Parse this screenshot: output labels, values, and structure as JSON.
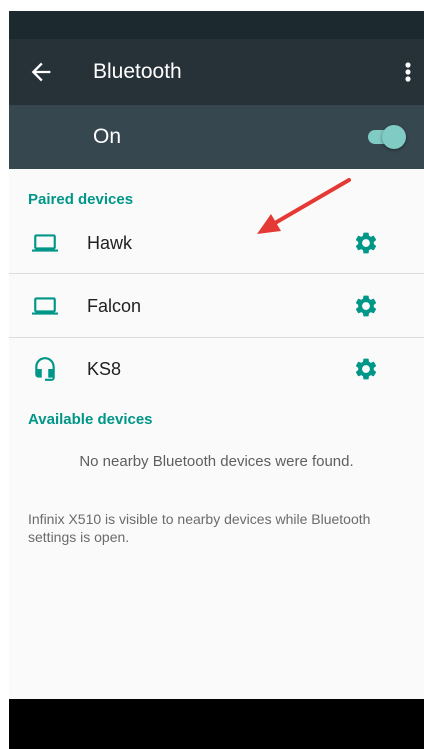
{
  "toolbar": {
    "title": "Bluetooth",
    "back_icon": "arrow-back-icon",
    "menu_icon": "more-vert-icon"
  },
  "master_switch": {
    "label": "On",
    "state": "on"
  },
  "paired": {
    "header": "Paired devices",
    "devices": [
      {
        "name": "Hawk",
        "icon": "laptop-icon"
      },
      {
        "name": "Falcon",
        "icon": "laptop-icon"
      },
      {
        "name": "KS8",
        "icon": "headset-icon"
      }
    ]
  },
  "available": {
    "header": "Available devices",
    "empty_message": "No nearby Bluetooth devices were found."
  },
  "footer": {
    "visibility_note": "Infinix X510 is visible to nearby devices while Bluetooth settings is open."
  },
  "colors": {
    "toolbar": "#263238",
    "master_bar": "#37474f",
    "accent": "#009688",
    "switch": "#80cbc4",
    "annotation_arrow": "#e53935"
  }
}
